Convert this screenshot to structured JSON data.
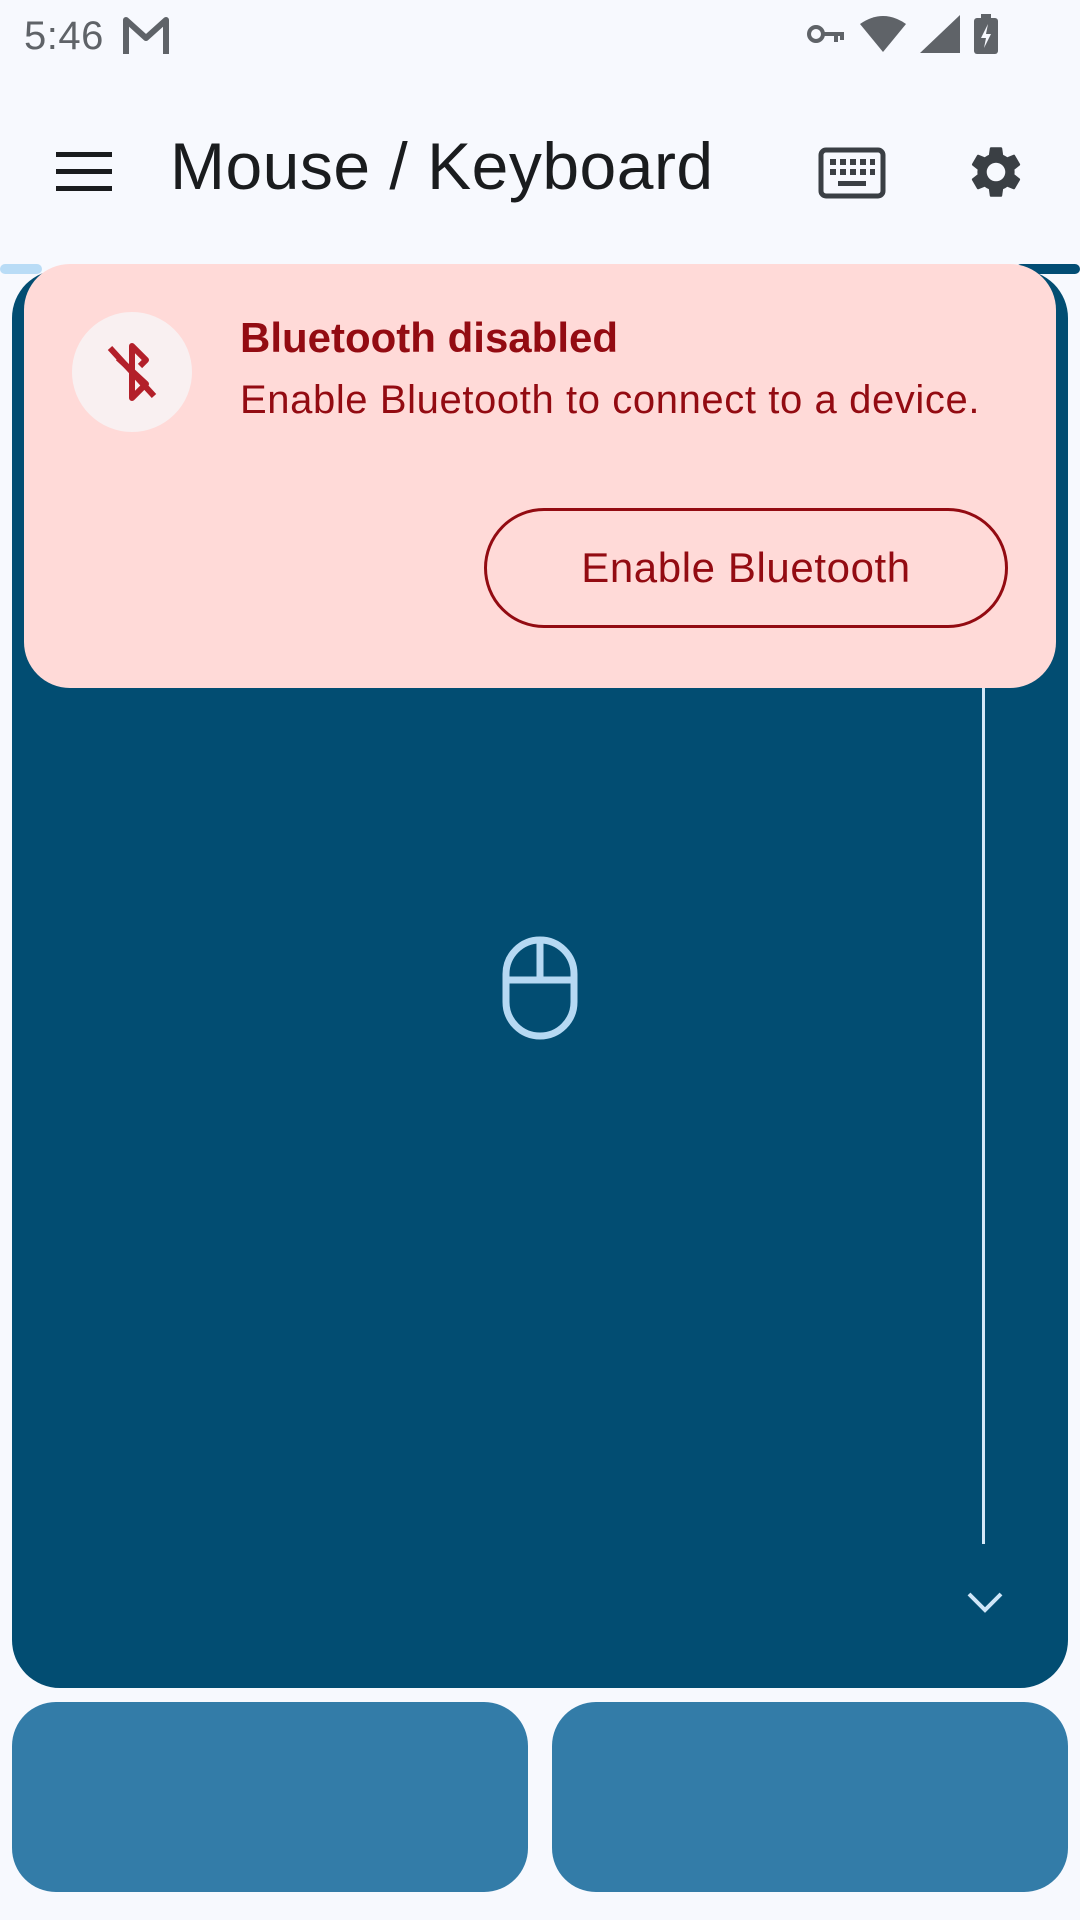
{
  "status_bar": {
    "time": "5:46",
    "icons": [
      "gmail-icon",
      "vpn-key-icon",
      "wifi-icon",
      "cell-signal-icon",
      "battery-charging-icon"
    ]
  },
  "app_bar": {
    "title": "Mouse / Keyboard",
    "icons": [
      "menu-icon",
      "keyboard-icon",
      "gear-icon"
    ]
  },
  "banner": {
    "icon": "bluetooth-disabled-icon",
    "title": "Bluetooth disabled",
    "message": "Enable Bluetooth to connect to a device.",
    "button_label": "Enable Bluetooth"
  },
  "touchpad": {
    "center_icon": "mouse-icon",
    "scroll_icon": "chevron-down-icon"
  },
  "colors": {
    "background": "#f7f9fe",
    "touchpad": "#024d72",
    "mouse_buttons": "#337ca8",
    "banner_bg": "#ffdad8",
    "banner_text": "#930b12"
  }
}
